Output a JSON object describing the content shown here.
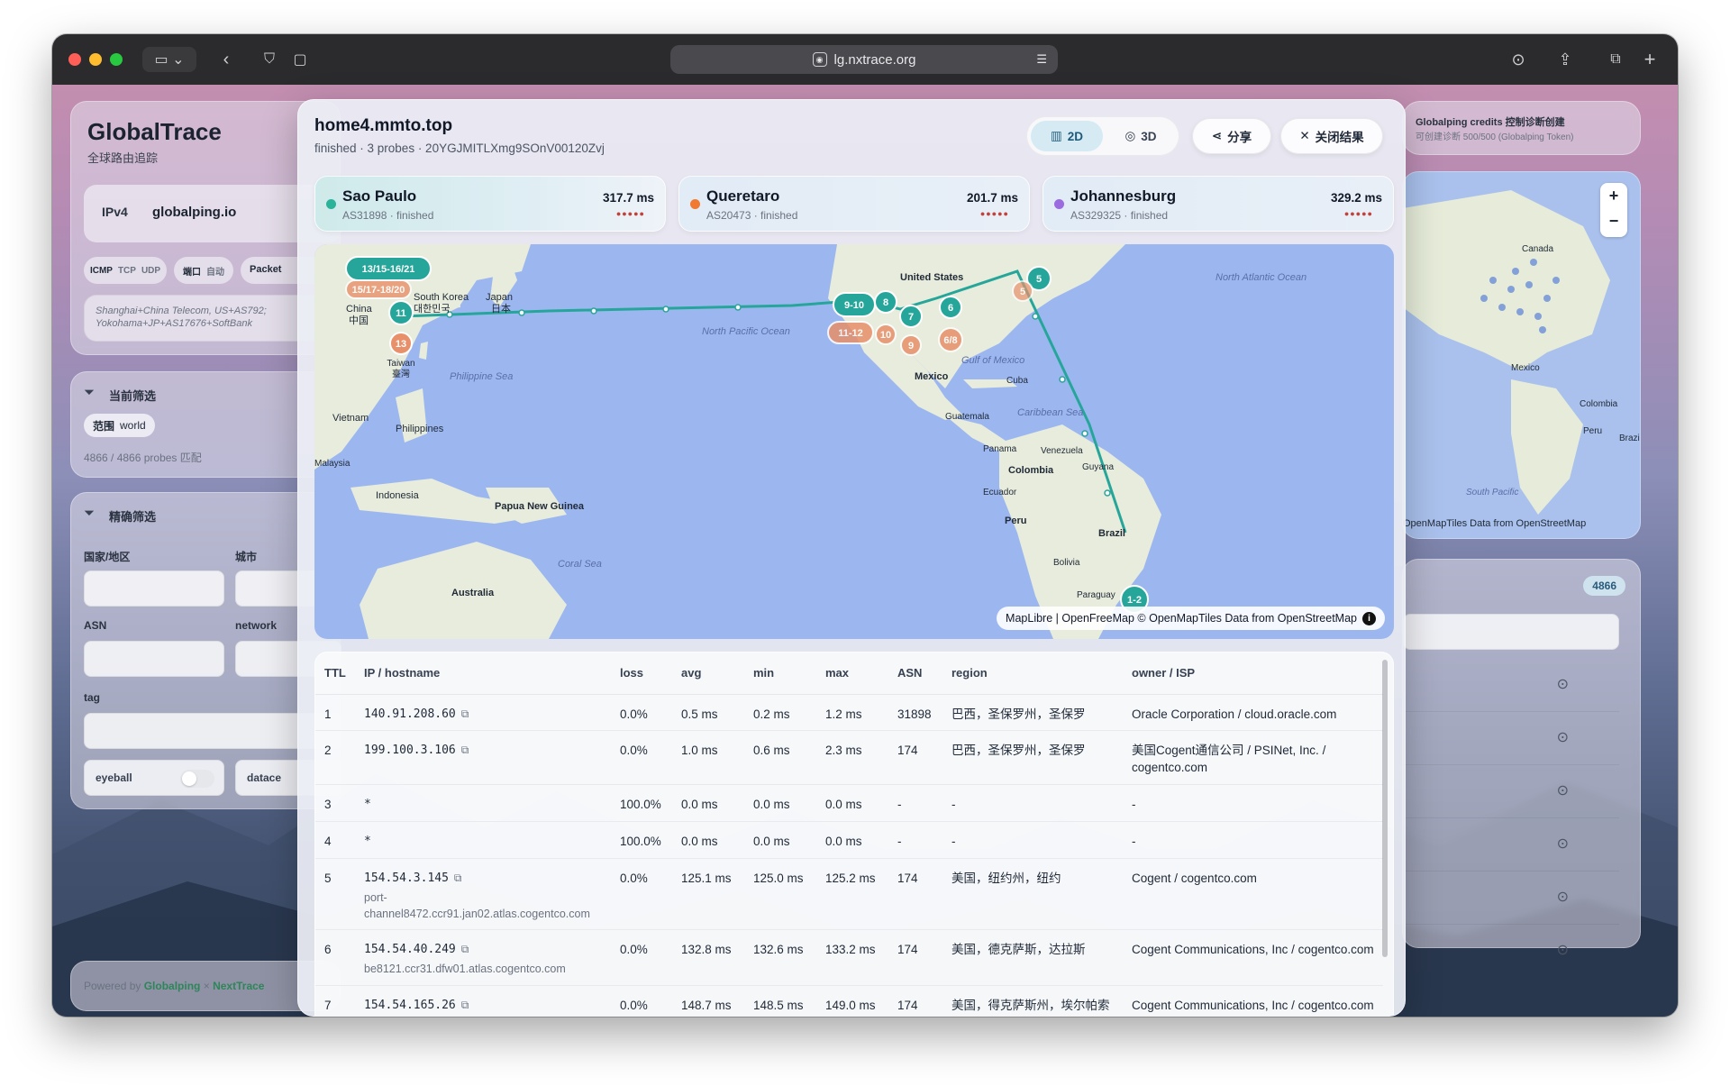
{
  "browser": {
    "url": "lg.nxtrace.org"
  },
  "sidebar": {
    "brand_title": "GlobalTrace",
    "brand_sub": "全球路由追踪",
    "ip_version": "IPv4",
    "provider": "globalping.io",
    "protocols": [
      "ICMP",
      "TCP",
      "UDP"
    ],
    "port_label": "端口",
    "port_value": "自动",
    "packets_label": "Packet",
    "location_text": "Shanghai+China Telecom, US+AS792; Yokohama+JP+AS17676+SoftBank",
    "current_filter_title": "当前筛选",
    "filter_key": "范围",
    "filter_value": "world",
    "probe_match": "4866 / 4866 probes 匹配",
    "precise_filter_title": "精确筛选",
    "country_label": "国家/地区",
    "city_label": "城市",
    "asn_label": "ASN",
    "network_label": "network",
    "tag_label": "tag",
    "eyeball_label": "eyeball",
    "datacenter_label": "datace",
    "powered_by": "Powered by",
    "powered_a": "Globalping",
    "powered_x": "×",
    "powered_b": "NextTrace"
  },
  "right_panel": {
    "credits_title": "Globalping credits 控制诊断创建",
    "credits_sub": "可创建诊断 500/500 (Globalping Token)",
    "zoom_in": "+",
    "zoom_out": "−",
    "map_labels": [
      "Canada",
      "Mexico",
      "Colombia",
      "Peru",
      "Brazil",
      "South Pacific"
    ],
    "attribution": "OpenMapTiles Data from OpenStreetMap",
    "count_badge": "4866"
  },
  "modal": {
    "title": "home4.mmto.top",
    "subtitle": "finished · 3 probes · 20YGJMITLXmg9SOnV00120Zvj",
    "btn_2d": "2D",
    "btn_3d": "3D",
    "btn_share": "分享",
    "btn_close": "关闭结果",
    "probes": [
      {
        "name": "Sao Paulo",
        "asn": "AS31898 · finished",
        "ms": "317.7 ms",
        "color": "#2bb39a",
        "bars": "●●●●●"
      },
      {
        "name": "Queretaro",
        "asn": "AS20473 · finished",
        "ms": "201.7 ms",
        "color": "#f07a32",
        "bars": "●●●●●"
      },
      {
        "name": "Johannesburg",
        "asn": "AS329325 · finished",
        "ms": "329.2 ms",
        "color": "#9b6be0",
        "bars": "●●●●●"
      }
    ],
    "map": {
      "place_labels": [
        {
          "text": "South Korea",
          "k": "korea"
        },
        {
          "text": "대한민국",
          "k": "korea2"
        },
        {
          "text": "Japan",
          "k": "japan"
        },
        {
          "text": "日本",
          "k": "japan2"
        },
        {
          "text": "China",
          "k": "china"
        },
        {
          "text": "中国",
          "k": "china2"
        },
        {
          "text": "Taiwan",
          "k": "taiwan"
        },
        {
          "text": "臺灣",
          "k": "taiwan2"
        },
        {
          "text": "Philippine Sea",
          "k": "phsea"
        },
        {
          "text": "Vietnam",
          "k": "vietnam"
        },
        {
          "text": "Philippines",
          "k": "philippines"
        },
        {
          "text": "Malaysia",
          "k": "malaysia"
        },
        {
          "text": "Indonesia",
          "k": "indonesia"
        },
        {
          "text": "Papua New Guinea",
          "k": "png"
        },
        {
          "text": "Coral Sea",
          "k": "coral"
        },
        {
          "text": "Australia",
          "k": "australia"
        },
        {
          "text": "North Pacific Ocean",
          "k": "npo"
        },
        {
          "text": "United States",
          "k": "us"
        },
        {
          "text": "North Atlantic Ocean",
          "k": "nao"
        },
        {
          "text": "Gulf of Mexico",
          "k": "gom"
        },
        {
          "text": "Mexico",
          "k": "mexico"
        },
        {
          "text": "Cuba",
          "k": "cuba"
        },
        {
          "text": "Guatemala",
          "k": "guatemala"
        },
        {
          "text": "Caribbean Sea",
          "k": "carib"
        },
        {
          "text": "Panama",
          "k": "panama"
        },
        {
          "text": "Venezuela",
          "k": "venezuela"
        },
        {
          "text": "Colombia",
          "k": "colombia"
        },
        {
          "text": "Guyana",
          "k": "guyana"
        },
        {
          "text": "Ecuador",
          "k": "ecuador"
        },
        {
          "text": "Peru",
          "k": "peru"
        },
        {
          "text": "Brazil",
          "k": "brazil"
        },
        {
          "text": "Bolivia",
          "k": "bolivia"
        },
        {
          "text": "Paraguay",
          "k": "paraguay"
        }
      ],
      "hop_markers": [
        {
          "label": "13/15-16/21",
          "color": "teal"
        },
        {
          "label": "15/17-18/20",
          "color": "orange"
        },
        {
          "label": "11",
          "color": "teal"
        },
        {
          "label": "13",
          "color": "orange"
        },
        {
          "label": "9-10",
          "color": "teal"
        },
        {
          "label": "8",
          "color": "teal"
        },
        {
          "label": "7",
          "color": "teal"
        },
        {
          "label": "6",
          "color": "teal"
        },
        {
          "label": "5",
          "color": "teal"
        },
        {
          "label": "11-12",
          "color": "orange"
        },
        {
          "label": "10",
          "color": "orange"
        },
        {
          "label": "9",
          "color": "orange"
        },
        {
          "label": "6/8",
          "color": "orange"
        },
        {
          "label": "5",
          "color": "orange"
        },
        {
          "label": "1-2",
          "color": "teal"
        }
      ],
      "attribution": "MapLibre | OpenFreeMap © OpenMapTiles Data from OpenStreetMap"
    },
    "table": {
      "headers": [
        "TTL",
        "IP / hostname",
        "loss",
        "avg",
        "min",
        "max",
        "ASN",
        "region",
        "owner / ISP"
      ],
      "rows": [
        {
          "ttl": "1",
          "ip": "140.91.208.60",
          "host": "",
          "loss": "0.0%",
          "avg": "0.5 ms",
          "min": "0.2 ms",
          "max": "1.2 ms",
          "asn": "31898",
          "region": "巴西，圣保罗州，圣保罗",
          "owner": "Oracle Corporation / cloud.oracle.com",
          "link": true
        },
        {
          "ttl": "2",
          "ip": "199.100.3.106",
          "host": "",
          "loss": "0.0%",
          "avg": "1.0 ms",
          "min": "0.6 ms",
          "max": "2.3 ms",
          "asn": "174",
          "region": "巴西，圣保罗州，圣保罗",
          "owner": "美国Cogent通信公司 / PSINet, Inc. / cogentco.com",
          "link": true
        },
        {
          "ttl": "3",
          "ip": "*",
          "host": "",
          "loss": "100.0%",
          "avg": "0.0 ms",
          "min": "0.0 ms",
          "max": "0.0 ms",
          "asn": "-",
          "region": "-",
          "owner": "-",
          "link": false
        },
        {
          "ttl": "4",
          "ip": "*",
          "host": "",
          "loss": "100.0%",
          "avg": "0.0 ms",
          "min": "0.0 ms",
          "max": "0.0 ms",
          "asn": "-",
          "region": "-",
          "owner": "-",
          "link": false
        },
        {
          "ttl": "5",
          "ip": "154.54.3.145",
          "host": "port-channel8472.ccr91.jan02.atlas.cogentco.com",
          "loss": "0.0%",
          "avg": "125.1 ms",
          "min": "125.0 ms",
          "max": "125.2 ms",
          "asn": "174",
          "region": "美国，纽约州，纽约",
          "owner": "Cogent / cogentco.com",
          "link": true
        },
        {
          "ttl": "6",
          "ip": "154.54.40.249",
          "host": "be8121.ccr31.dfw01.atlas.cogentco.com",
          "loss": "0.0%",
          "avg": "132.8 ms",
          "min": "132.6 ms",
          "max": "133.2 ms",
          "asn": "174",
          "region": "美国，德克萨斯，达拉斯",
          "owner": "Cogent Communications, Inc / cogentco.com",
          "link": true
        },
        {
          "ttl": "7",
          "ip": "154.54.165.26",
          "host": "",
          "loss": "0.0%",
          "avg": "148.7 ms",
          "min": "148.5 ms",
          "max": "149.0 ms",
          "asn": "174",
          "region": "美国，得克萨斯州，埃尔帕索",
          "owner": "Cogent Communications, Inc / cogentco.com",
          "link": true
        }
      ]
    }
  }
}
